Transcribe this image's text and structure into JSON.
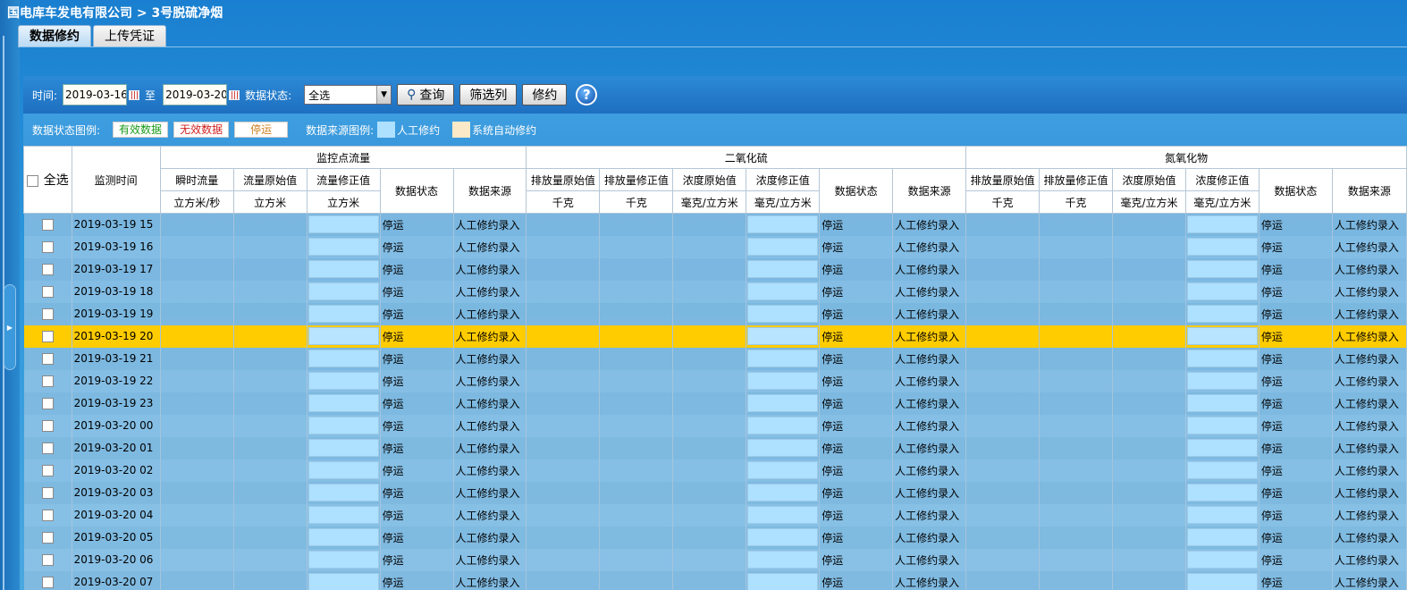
{
  "breadcrumb": "国电库车发电有限公司 > 3号脱硫净烟",
  "tabs": [
    {
      "label": "数据修约",
      "active": true
    },
    {
      "label": "上传凭证",
      "active": false
    }
  ],
  "toolbar": {
    "time_label": "时间:",
    "start_date": "2019-03-16",
    "to_label": "至",
    "end_date": "2019-03-20",
    "status_label": "数据状态:",
    "status_selected": "全选",
    "query_label": "查询",
    "filter_columns_label": "筛选列",
    "revise_label": "修约"
  },
  "legend": {
    "status_label": "数据状态图例:",
    "valid": "有效数据",
    "invalid": "无效数据",
    "stopped": "停运",
    "source_label": "数据来源图例:",
    "manual": "人工修约",
    "auto": "系统自动修约"
  },
  "table": {
    "select_all": "全选",
    "time_header": "监测时间",
    "groups": [
      "监控点流量",
      "二氧化硫",
      "氮氧化物"
    ],
    "flow_columns": [
      {
        "name": "瞬时流量",
        "unit": "立方米/秒"
      },
      {
        "name": "流量原始值",
        "unit": "立方米"
      },
      {
        "name": "流量修正值",
        "unit": "立方米"
      },
      {
        "name": "数据状态"
      },
      {
        "name": "数据来源"
      }
    ],
    "so2_columns": [
      {
        "name": "排放量原始值",
        "unit": "千克"
      },
      {
        "name": "排放量修正值",
        "unit": "千克"
      },
      {
        "name": "浓度原始值",
        "unit": "毫克/立方米"
      },
      {
        "name": "浓度修正值",
        "unit": "毫克/立方米"
      },
      {
        "name": "数据状态"
      },
      {
        "name": "数据来源"
      }
    ],
    "nox_columns": [
      {
        "name": "排放量原始值",
        "unit": "千克"
      },
      {
        "name": "排放量修正值",
        "unit": "千克"
      },
      {
        "name": "浓度原始值",
        "unit": "毫克/立方米"
      },
      {
        "name": "浓度修正值",
        "unit": "毫克/立方米"
      },
      {
        "name": "数据状态"
      },
      {
        "name": "数据来源"
      }
    ],
    "selected_row_index": 5,
    "rows": [
      {
        "time": "2019-03-19 15",
        "status": "停运",
        "source": "人工修约录入"
      },
      {
        "time": "2019-03-19 16",
        "status": "停运",
        "source": "人工修约录入"
      },
      {
        "time": "2019-03-19 17",
        "status": "停运",
        "source": "人工修约录入"
      },
      {
        "time": "2019-03-19 18",
        "status": "停运",
        "source": "人工修约录入"
      },
      {
        "time": "2019-03-19 19",
        "status": "停运",
        "source": "人工修约录入"
      },
      {
        "time": "2019-03-19 20",
        "status": "停运",
        "source": "人工修约录入"
      },
      {
        "time": "2019-03-19 21",
        "status": "停运",
        "source": "人工修约录入"
      },
      {
        "time": "2019-03-19 22",
        "status": "停运",
        "source": "人工修约录入"
      },
      {
        "time": "2019-03-19 23",
        "status": "停运",
        "source": "人工修约录入"
      },
      {
        "time": "2019-03-20 00",
        "status": "停运",
        "source": "人工修约录入"
      },
      {
        "time": "2019-03-20 01",
        "status": "停运",
        "source": "人工修约录入"
      },
      {
        "time": "2019-03-20 02",
        "status": "停运",
        "source": "人工修约录入"
      },
      {
        "time": "2019-03-20 03",
        "status": "停运",
        "source": "人工修约录入"
      },
      {
        "time": "2019-03-20 04",
        "status": "停运",
        "source": "人工修约录入"
      },
      {
        "time": "2019-03-20 05",
        "status": "停运",
        "source": "人工修约录入"
      },
      {
        "time": "2019-03-20 06",
        "status": "停运",
        "source": "人工修约录入"
      },
      {
        "time": "2019-03-20 07",
        "status": "停运",
        "source": "人工修约录入"
      }
    ]
  },
  "colors": {
    "selected_row": "#ffcc00",
    "manual_swatch": "#aee0ff",
    "auto_swatch": "#fbe9c7"
  }
}
